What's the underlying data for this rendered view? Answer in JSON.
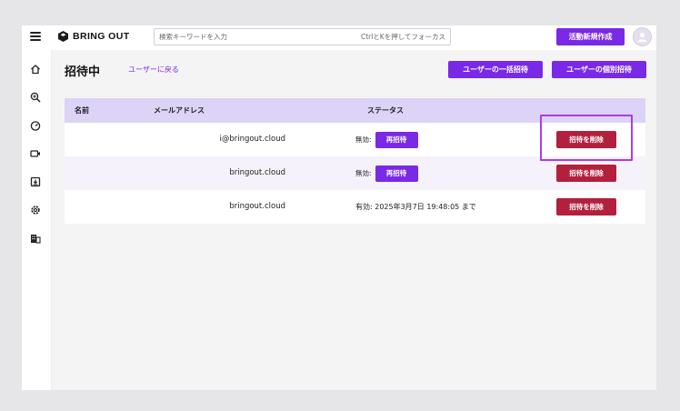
{
  "header": {
    "logo_text": "BRING OUT",
    "search_placeholder": "検索キーワードを入力",
    "search_hint": "CtrlとKを押してフォーカス",
    "new_activity_label": "活動新規作成"
  },
  "page": {
    "title": "招待中",
    "back_link": "ユーザーに戻る",
    "bulk_invite_label": "ユーザーの一括招待",
    "single_invite_label": "ユーザーの個別招待"
  },
  "table": {
    "columns": [
      "名前",
      "メールアドレス",
      "ステータス"
    ],
    "rows": [
      {
        "name": "",
        "email": "i@bringout.cloud",
        "status": "無効:",
        "reinvite": "再招待",
        "delete": "招待を削除"
      },
      {
        "name": "",
        "email": "bringout.cloud",
        "status": "無効:",
        "reinvite": "再招待",
        "delete": "招待を削除"
      },
      {
        "name": "",
        "email": "bringout.cloud",
        "status": "有効: 2025年3月7日 19:48:05 まで",
        "reinvite": "",
        "delete": "招待を削除"
      }
    ]
  },
  "colors": {
    "accent": "#7a29e6",
    "danger": "#b3203d",
    "header_row": "#dcd3f7",
    "highlight": "#a93de6"
  },
  "sidebar_icons": [
    "home-icon",
    "search-zoom-icon",
    "dashboard-icon",
    "video-icon",
    "download-icon",
    "settings-icon",
    "building-icon"
  ]
}
